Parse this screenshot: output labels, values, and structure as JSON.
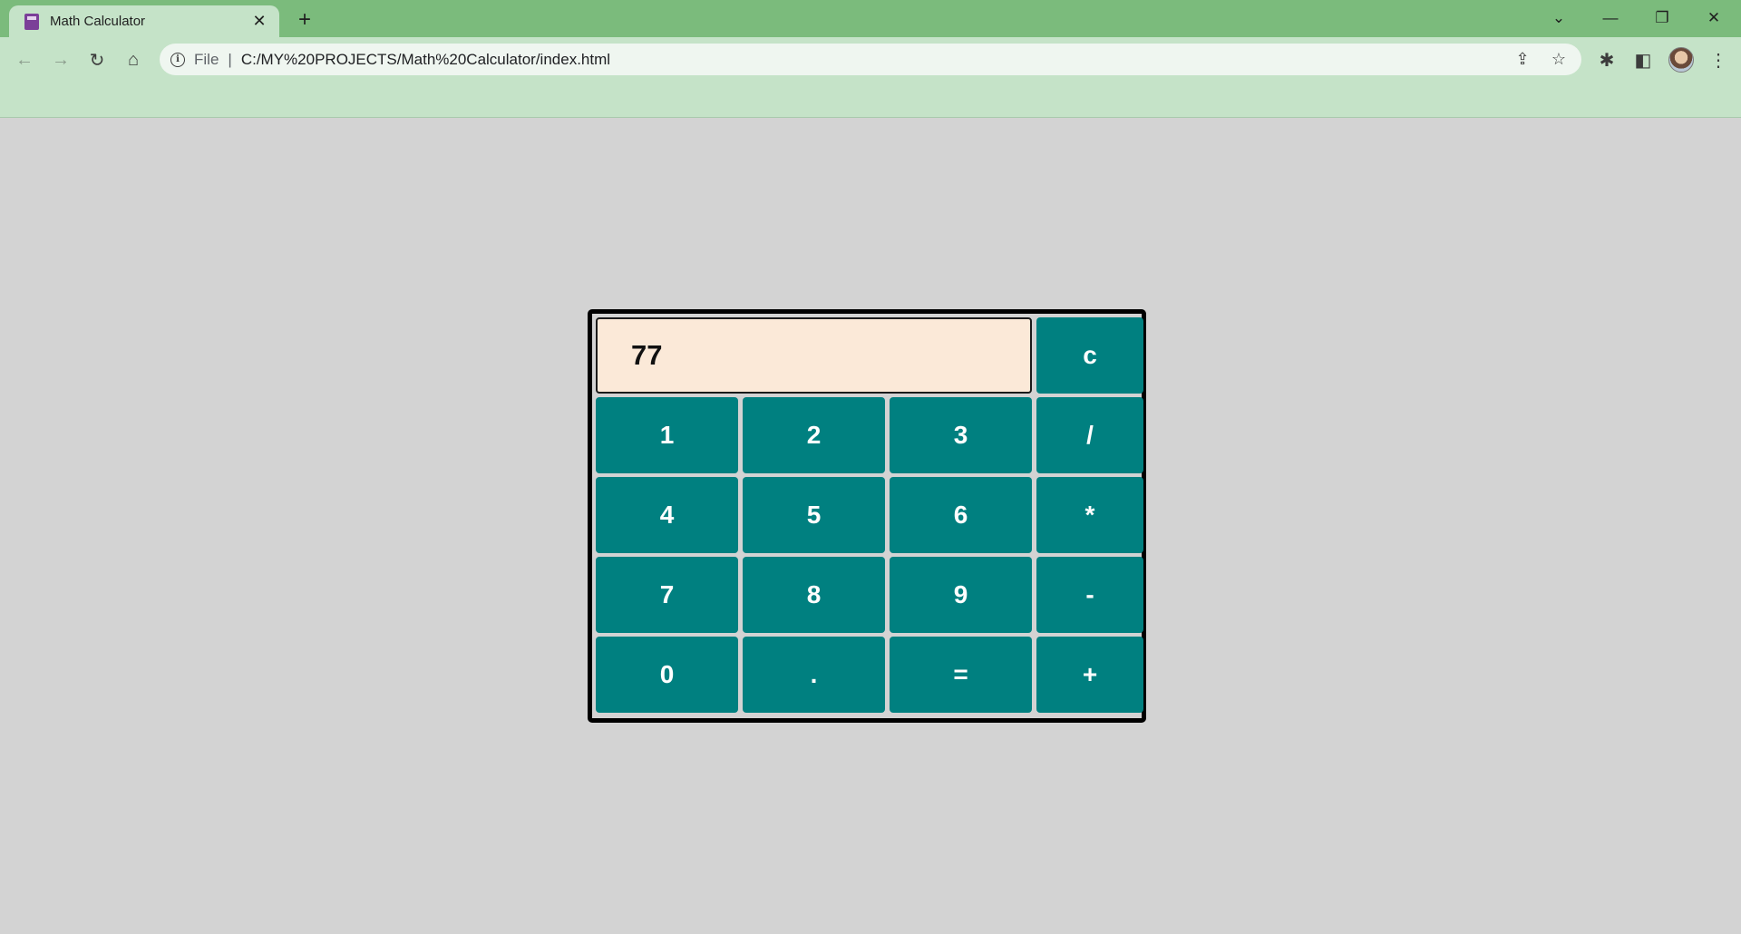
{
  "browser": {
    "tab_title": "Math Calculator",
    "tab_close": "✕",
    "new_tab": "+",
    "window_controls": {
      "tab_search": "⌄",
      "minimize": "—",
      "restore": "❐",
      "close": "✕"
    },
    "nav": {
      "back": "←",
      "forward": "→",
      "reload": "↻",
      "home": "⌂"
    },
    "address": {
      "info_glyph": "i",
      "scheme": "File",
      "separator": "|",
      "url": "C:/MY%20PROJECTS/Math%20Calculator/index.html",
      "share_icon": "⇪",
      "bookmark_icon": "☆"
    },
    "toolbar": {
      "extensions_icon": "✱",
      "sidepanel_icon": "◧",
      "menu_icon": "⋮"
    }
  },
  "calculator": {
    "display_value": "77",
    "clear_label": "c",
    "keys": [
      {
        "label": "1"
      },
      {
        "label": "2"
      },
      {
        "label": "3"
      },
      {
        "label": "/"
      },
      {
        "label": "4"
      },
      {
        "label": "5"
      },
      {
        "label": "6"
      },
      {
        "label": "*"
      },
      {
        "label": "7"
      },
      {
        "label": "8"
      },
      {
        "label": "9"
      },
      {
        "label": "-"
      },
      {
        "label": "0"
      },
      {
        "label": "."
      },
      {
        "label": "="
      },
      {
        "label": "+"
      }
    ],
    "colors": {
      "key_bg": "#008080",
      "display_bg": "#fbe9d8",
      "page_bg": "#d3d3d3"
    }
  }
}
